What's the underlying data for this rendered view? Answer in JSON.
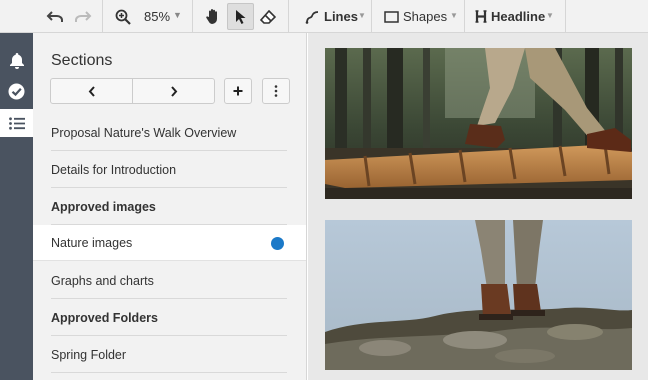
{
  "toolbar": {
    "zoom": "85%",
    "lines_label": "Lines",
    "shapes_label": "Shapes",
    "headline_label": "Headline",
    "icons": [
      "undo-icon",
      "redo-icon",
      "zoom-icon",
      "hand-icon",
      "pointer-icon",
      "eraser-icon",
      "lines-icon",
      "shapes-icon",
      "headline-icon"
    ]
  },
  "rail": {
    "icons": [
      "bell-icon",
      "check-circle-icon",
      "list-icon"
    ],
    "active": "list-icon"
  },
  "panel": {
    "title": "Sections",
    "items": [
      {
        "label": "Proposal Nature's Walk Overview",
        "bold": false
      },
      {
        "label": "Details for Introduction",
        "bold": false
      },
      {
        "label": "Approved images",
        "bold": true
      },
      {
        "label": "Nature images",
        "bold": false,
        "selected": true
      },
      {
        "label": "Graphs and charts",
        "bold": false
      },
      {
        "label": "Approved Folders",
        "bold": true
      },
      {
        "label": "Spring Folder",
        "bold": false
      }
    ]
  },
  "colors": {
    "accent": "#1b79c8",
    "rail": "#4a5360",
    "panel": "#f2f2f2"
  }
}
